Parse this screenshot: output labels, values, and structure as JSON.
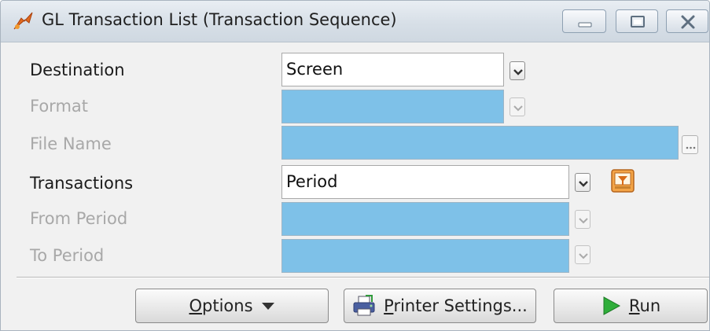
{
  "window": {
    "title": "GL Transaction List (Transaction Sequence)",
    "icon": "app-logo-icon"
  },
  "window_controls": {
    "minimize_icon": "minimize-icon",
    "maximize_icon": "maximize-icon",
    "close_icon": "close-icon"
  },
  "form": {
    "destination": {
      "label": "Destination",
      "value": "Screen",
      "enabled": true
    },
    "format": {
      "label": "Format",
      "value": "",
      "enabled": false
    },
    "file_name": {
      "label": "File Name",
      "value": "",
      "enabled": false
    },
    "transactions": {
      "label": "Transactions",
      "value": "Period",
      "enabled": true
    },
    "from_period": {
      "label": "From Period",
      "value": "",
      "enabled": false
    },
    "to_period": {
      "label": "To Period",
      "value": "",
      "enabled": false
    }
  },
  "buttons": {
    "options": {
      "mnemonic": "O",
      "rest": "ptions"
    },
    "printer_settings": {
      "mnemonic": "P",
      "rest": "rinter Settings..."
    },
    "run": {
      "mnemonic": "R",
      "rest": "un"
    }
  },
  "colors": {
    "disabled_field": "#7ec1e8",
    "enabled_field": "#ffffff",
    "run_icon": "#2fae3a"
  }
}
